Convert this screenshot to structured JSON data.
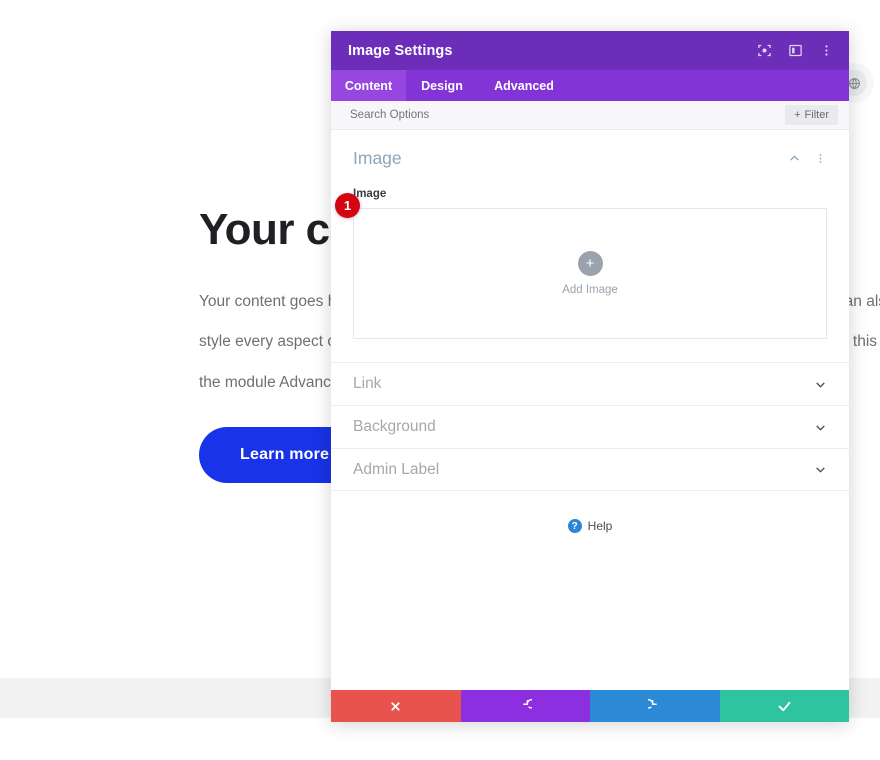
{
  "background_page": {
    "heading": "Your call to action",
    "paragraphs": [
      "Your content goes here. Edit or remove this text inline or in the module Content settings. You can also",
      "style every aspect of this content in the module Design settings and even apply custom CSS to this text in",
      "the module Advanced settings."
    ],
    "button_label": "Learn more",
    "widget_icon": "globe-icon"
  },
  "modal": {
    "title": "Image Settings",
    "header_icons": [
      {
        "name": "focus-target-icon"
      },
      {
        "name": "panel-layout-icon"
      },
      {
        "name": "more-vertical-icon"
      }
    ],
    "tabs": [
      {
        "label": "Content",
        "active": true
      },
      {
        "label": "Design",
        "active": false
      },
      {
        "label": "Advanced",
        "active": false
      }
    ],
    "search": {
      "placeholder": "Search Options",
      "value": ""
    },
    "filter_button": {
      "label": "Filter",
      "plus": "+"
    },
    "open_section": {
      "title": "Image",
      "collapse_icon": "chevron-up-icon",
      "menu_icon": "more-vertical-icon",
      "field_label": "Image",
      "upload": {
        "plus": "+",
        "label": "Add Image"
      },
      "step_badge": "1"
    },
    "collapsed_sections": [
      {
        "title": "Link",
        "chevron": "chevron-down-icon"
      },
      {
        "title": "Background",
        "chevron": "chevron-down-icon"
      },
      {
        "title": "Admin Label",
        "chevron": "chevron-down-icon"
      }
    ],
    "help": {
      "icon_glyph": "?",
      "label": "Help"
    },
    "action_buttons": [
      {
        "name": "close-button",
        "icon": "x-icon",
        "color": "#e8544d"
      },
      {
        "name": "undo-button",
        "icon": "undo-icon",
        "color": "#8b2fe0"
      },
      {
        "name": "redo-button",
        "icon": "redo-icon",
        "color": "#2c89d6"
      },
      {
        "name": "save-button",
        "icon": "check-icon",
        "color": "#2ec4a0"
      }
    ]
  },
  "colors": {
    "header_purple": "#6c2eb9",
    "tabbar_purple": "#8334d6",
    "tab_active_purple": "#9647e0",
    "cta_blue": "#1833e8",
    "badge_red": "#d40511"
  }
}
